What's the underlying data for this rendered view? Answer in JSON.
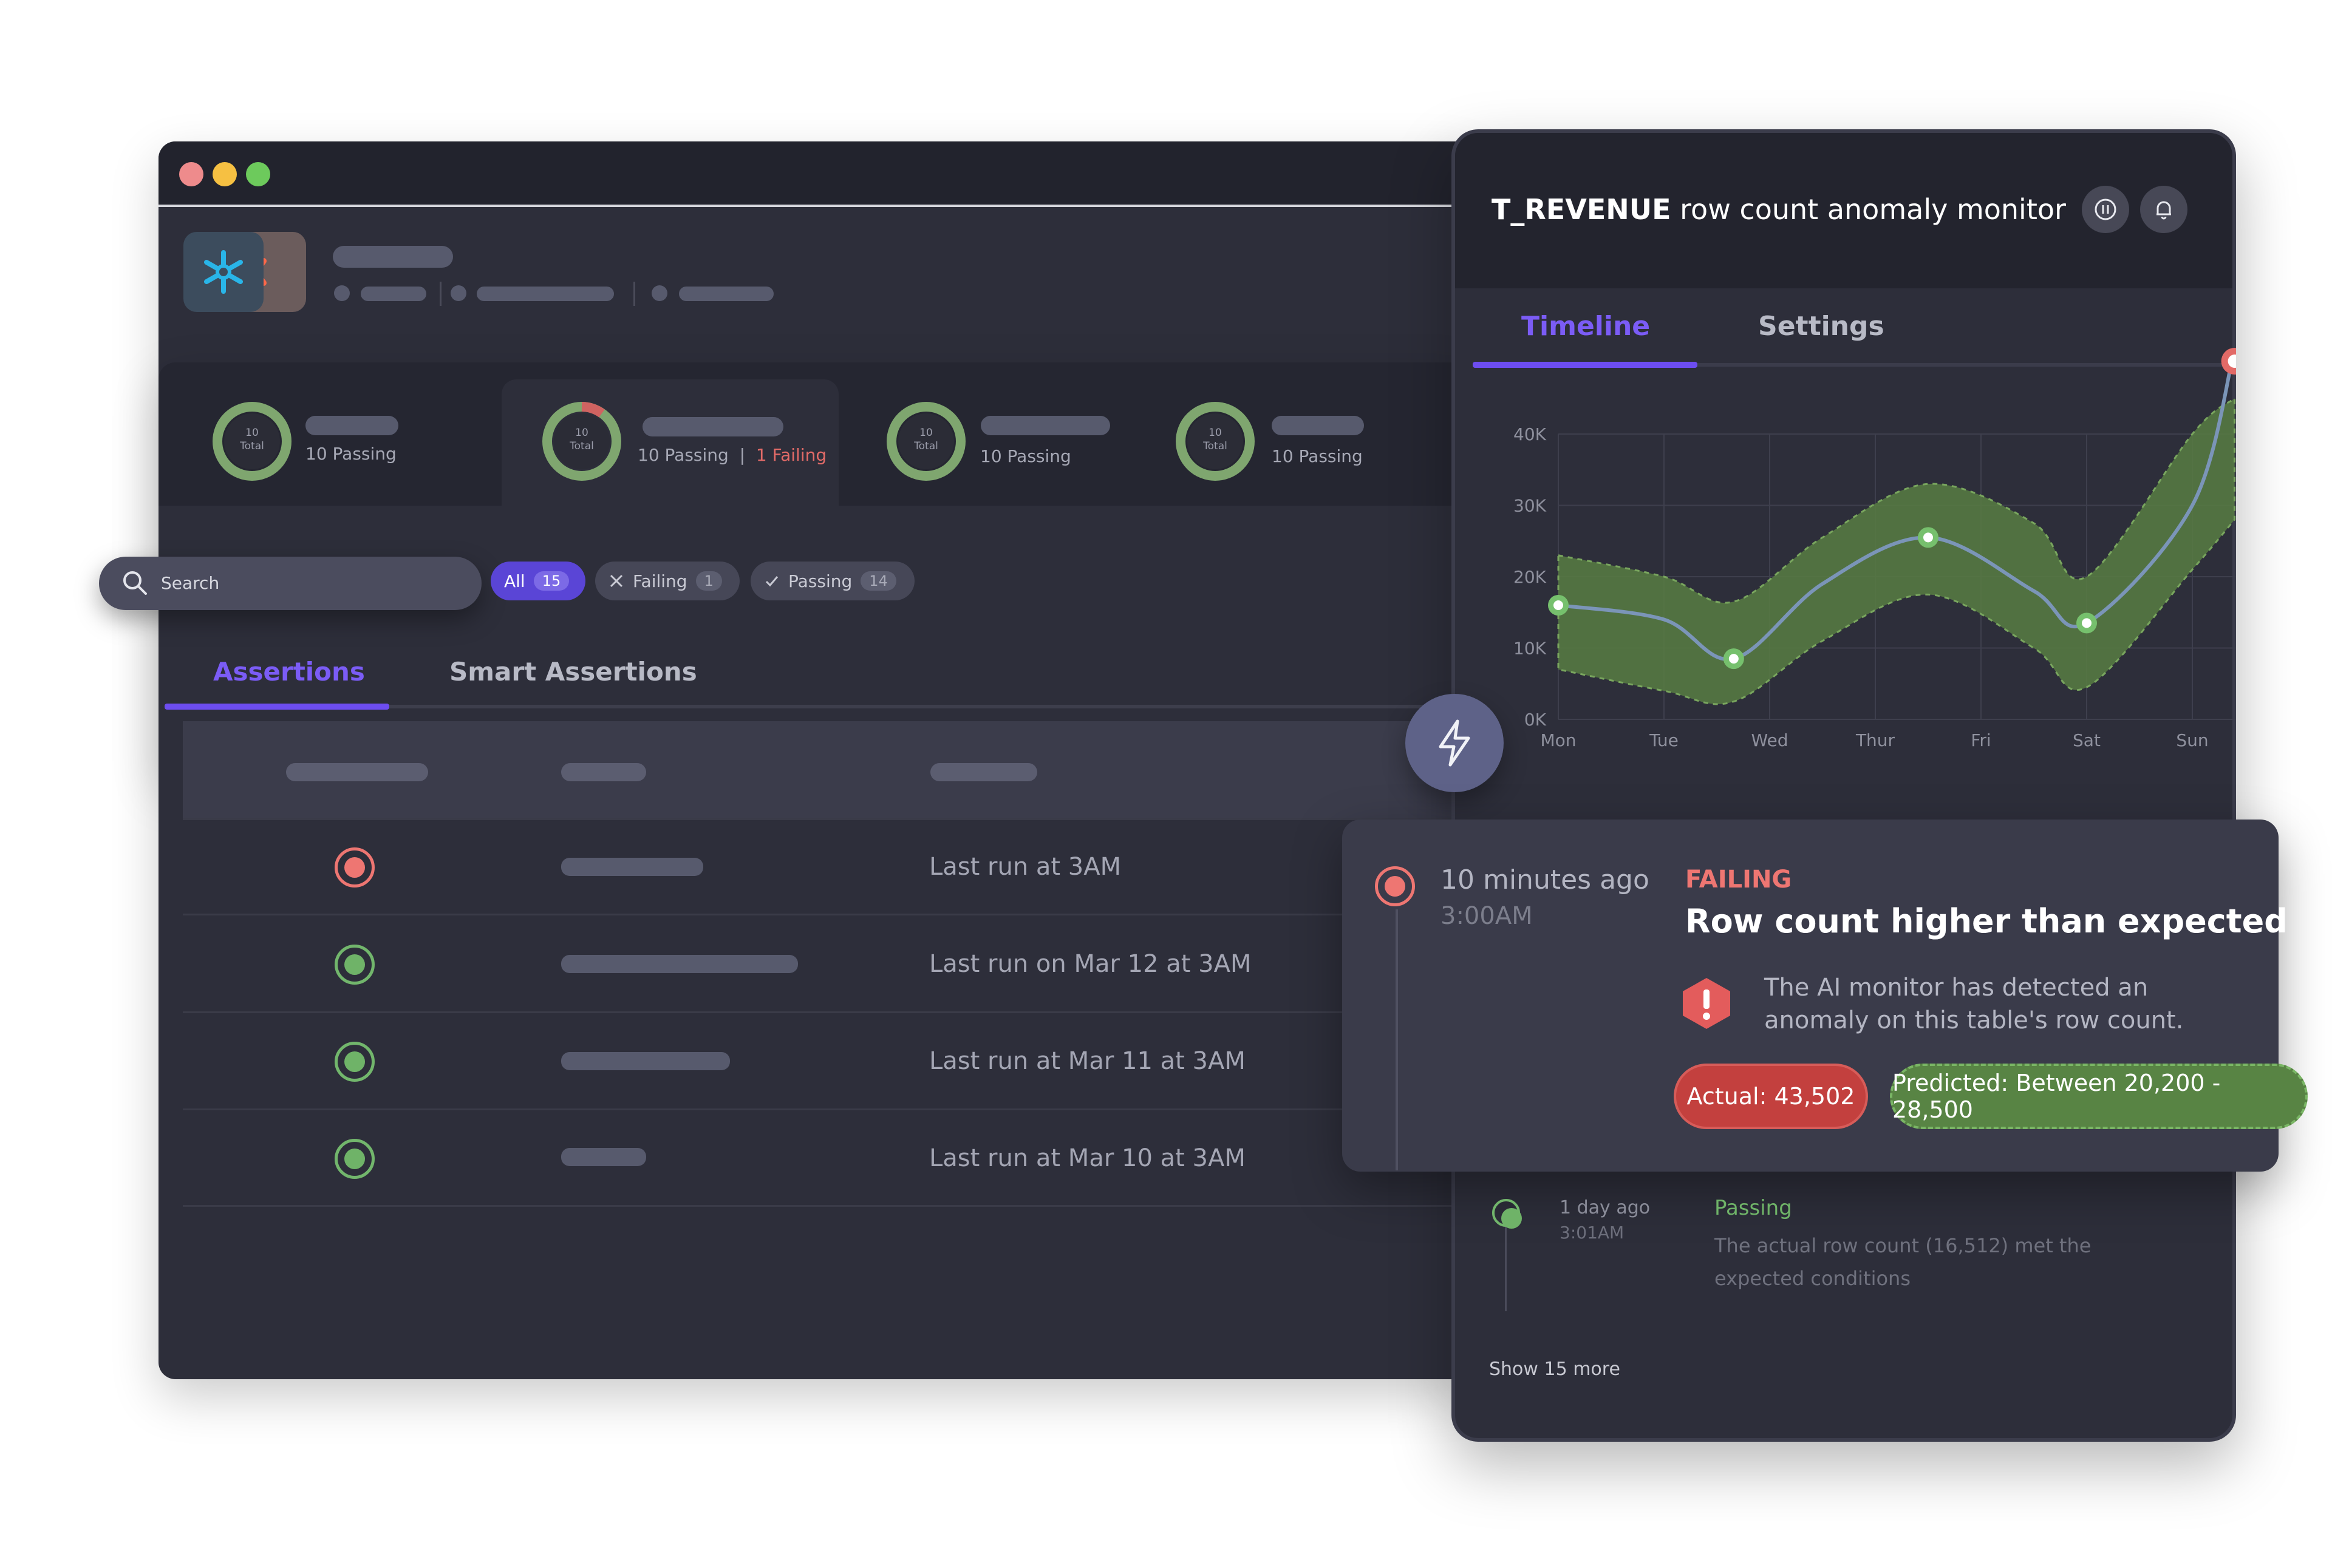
{
  "stats": [
    {
      "ring_total": "10",
      "ring_label": "Total",
      "passing": "10 Passing",
      "failing": ""
    },
    {
      "ring_total": "10",
      "ring_label": "Total",
      "passing": "10 Passing",
      "separator": "|",
      "failing": "1 Failing"
    },
    {
      "ring_total": "10",
      "ring_label": "Total",
      "passing": "10 Passing",
      "failing": ""
    },
    {
      "ring_total": "10",
      "ring_label": "Total",
      "passing": "10 Passing",
      "failing": ""
    }
  ],
  "search": {
    "placeholder": "Search"
  },
  "filters": {
    "all": {
      "label": "All",
      "count": "15"
    },
    "failing": {
      "label": "Failing",
      "count": "1"
    },
    "passing": {
      "label": "Passing",
      "count": "14"
    }
  },
  "tabs": {
    "assertions": "Assertions",
    "smart_assertions": "Smart Assertions"
  },
  "rows": [
    {
      "status": "failing",
      "last_run": "Last run at 3AM"
    },
    {
      "status": "passing",
      "last_run": "Last run on Mar 12 at 3AM"
    },
    {
      "status": "passing",
      "last_run": "Last run at Mar 11 at 3AM"
    },
    {
      "status": "passing",
      "last_run": "Last run at  Mar 10 at 3AM"
    }
  ],
  "monitor": {
    "title_table": "T_REVENUE",
    "title_rest": " row count anomaly monitor",
    "tabs": {
      "timeline": "Timeline",
      "settings": "Settings"
    }
  },
  "chart_data": {
    "type": "line",
    "x": [
      "Mon",
      "Tue",
      "Wed",
      "Thur",
      "Fri",
      "Sat",
      "Sun"
    ],
    "y_ticks": [
      "0K",
      "10K",
      "20K",
      "30K",
      "40K"
    ],
    "ylim": [
      0,
      40000
    ],
    "series": [
      {
        "values": [
          16000,
          14000,
          8500,
          19000,
          25500,
          18000,
          13500,
          30000,
          52000
        ],
        "x_index": [
          0,
          1,
          1.66,
          2.5,
          3.5,
          4.5,
          5,
          6,
          6.4
        ]
      }
    ],
    "band": {
      "lower": [
        7000,
        4000,
        2500,
        11000,
        17500,
        10000,
        4500,
        21000,
        28000
      ],
      "upper": [
        23000,
        20000,
        16500,
        25500,
        33000,
        27500,
        20000,
        40000,
        45000
      ]
    },
    "markers": [
      {
        "x_index": 0,
        "y": 16000,
        "status": "passing"
      },
      {
        "x_index": 1.66,
        "y": 8500,
        "status": "passing"
      },
      {
        "x_index": 3.5,
        "y": 25500,
        "status": "passing"
      },
      {
        "x_index": 5,
        "y": 13500,
        "status": "passing"
      },
      {
        "x_index": 6.4,
        "y": 52000,
        "status": "failing"
      }
    ],
    "colors": {
      "line": "#7b95b8",
      "band": "#587d43",
      "pass": "#76c06d",
      "fail": "#e26a67"
    }
  },
  "event": {
    "time_ago": "10 minutes ago",
    "time": "3:00AM",
    "status": "FAILING",
    "heading": "Row count higher than expected",
    "description": "The AI monitor has detected an anomaly on this table's row count.",
    "actual": "Actual: 43,502",
    "predicted": "Predicted: Between 20,200 - 28,500"
  },
  "pass_event": {
    "time_ago": "1 day ago",
    "time": "3:01AM",
    "status": "Passing",
    "description": "The actual row count (16,512) met the expected conditions"
  },
  "show_more": "Show 15 more",
  "colors": {
    "accent": "#6d4df0",
    "fail": "#ee7672",
    "pass": "#6fb368",
    "bg": "#2d2e3a"
  }
}
